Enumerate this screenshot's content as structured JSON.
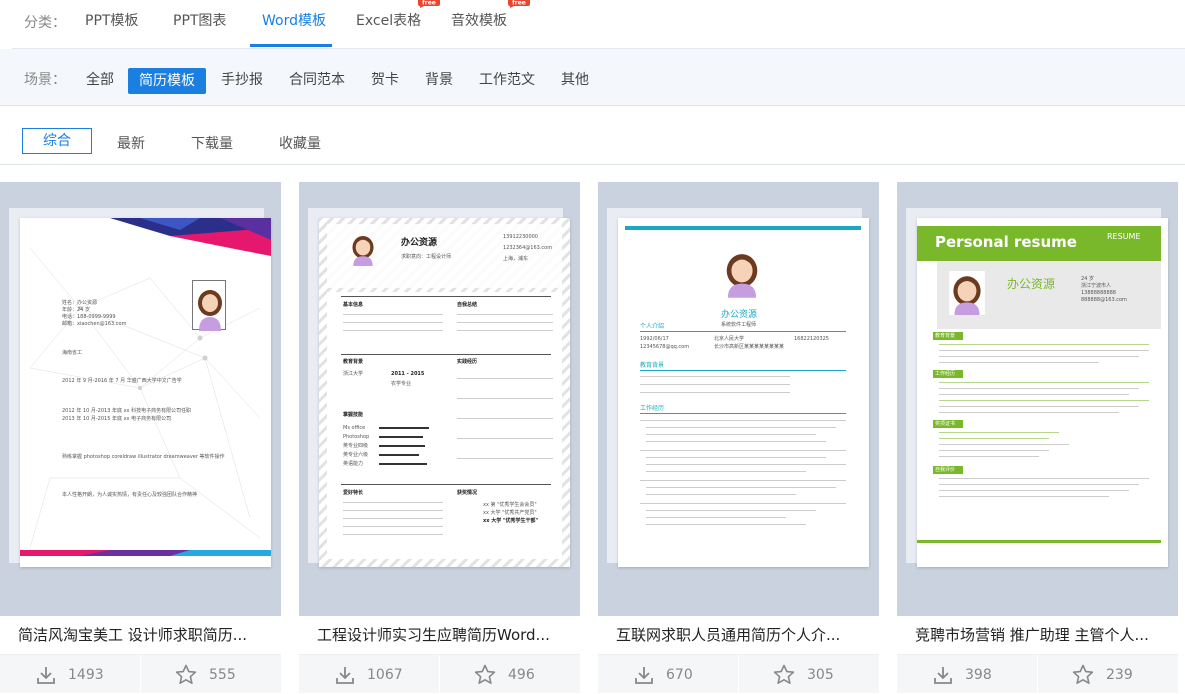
{
  "filter": {
    "category_label": "分类：",
    "categories": [
      {
        "label": "PPT模板"
      },
      {
        "label": "PPT图表"
      },
      {
        "label": "Word模板"
      },
      {
        "label": "Excel表格",
        "badge": "free"
      },
      {
        "label": "音效模板",
        "badge": "free"
      }
    ],
    "active_category": "Word模板",
    "scene_label": "场景：",
    "scenes": [
      "全部",
      "简历模板",
      "手抄报",
      "合同范本",
      "贺卡",
      "背景",
      "工作范文",
      "其他"
    ],
    "active_scene": "简历模板",
    "sorts": [
      "综合",
      "最新",
      "下载量",
      "收藏量"
    ],
    "active_sort": "综合"
  },
  "colors": {
    "accent": "#1a7fe0",
    "thumb_bg": "#c9d2de",
    "free_badge": "#e8462f",
    "green": "#7ab82b"
  },
  "cards": [
    {
      "title": "简洁风淘宝美工 设计师求职简历...",
      "downloads": "1493",
      "favorites": "555",
      "preview": {
        "lines": [
          "姓名：办公资源",
          "年龄：24 岁",
          "电话：188-0999-9999",
          "邮箱：xiaochen@163.com",
          "海南省工",
          "2012 年 9 月-2016 年 7 月 华盛广西大学中文广告学",
          "2012 年 10 月-2013 年底 xx 科技电子商务有限公司任职",
          "2013 年 10 月-2015 年底 xx 电子商务有限公司",
          "熟练掌握 photoshop coreldraw illustrator dreamweaver 等软件操作",
          "本人性格开朗，为人诚实热情，有责任心及较强团队合作精神"
        ]
      }
    },
    {
      "title": "工程设计师实习生应聘简历Word...",
      "downloads": "1067",
      "favorites": "496",
      "preview": {
        "name": "办公资源",
        "subtitle": "求职意向：工程设计师",
        "phone": "13912230000",
        "email": "1232364@163.com",
        "location": "上海，浦东",
        "sections": [
          "基本信息",
          "自我总结",
          "教育背景",
          "实践经历",
          "掌握技能",
          "爱好特长",
          "获奖情况"
        ],
        "skills": [
          "Ms office",
          "Photoshop",
          "英专业四级",
          "英专业六级",
          "英语能力"
        ],
        "school": "浙江大学",
        "period": "2011 - 2015",
        "degree": "农学专业",
        "awards": [
          "xx 第 \"优秀学生会会员\"",
          "xx 大学 \"优秀共产党员\"",
          "xx 大学 \"优秀学生干部\""
        ]
      }
    },
    {
      "title": "互联网求职人员通用简历个人介...",
      "downloads": "670",
      "favorites": "305",
      "preview": {
        "name": "办公资源",
        "subtitle": "系统软件工程师",
        "sections": [
          "个人介绍",
          "教育背景",
          "工作经历"
        ],
        "info": [
          "1992/06/17",
          "12345678@qq.com",
          "北京人民大学",
          "16822120325",
          "长沙市高新区某某某某某某某某"
        ]
      }
    },
    {
      "title": "竞聘市场营销 推广助理 主管个人...",
      "downloads": "398",
      "favorites": "239",
      "preview": {
        "banner": "Personal resume",
        "resume_tag": "RESUME",
        "name": "办公资源",
        "sections": [
          "教育背景",
          "工作经历",
          "奖项证书",
          "自我评价"
        ],
        "contact": [
          "24 岁",
          "浙江宁波市人",
          "13888888888",
          "888888@163.com"
        ]
      }
    }
  ]
}
